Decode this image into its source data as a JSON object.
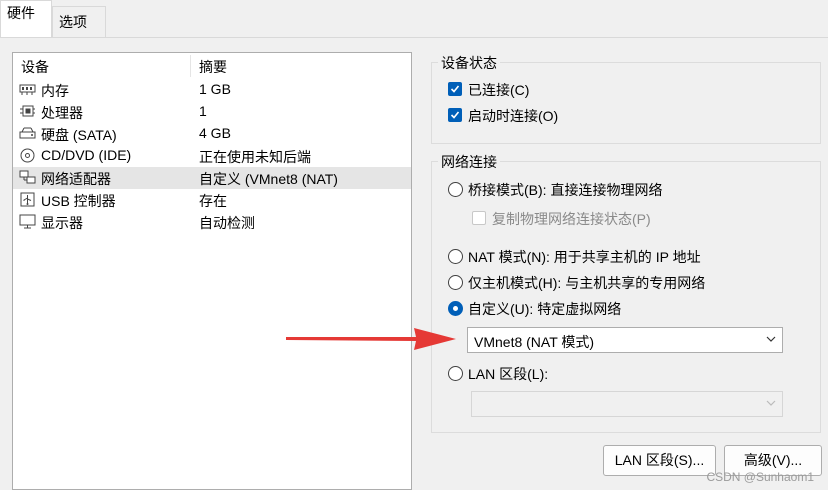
{
  "tabs": [
    {
      "label": "硬件",
      "active": true
    },
    {
      "label": "选项",
      "active": false
    }
  ],
  "hardware_list": {
    "columns": [
      "设备",
      "摘要"
    ],
    "rows": [
      {
        "icon": "memory-icon",
        "name": "内存",
        "summary": "1 GB",
        "selected": false
      },
      {
        "icon": "processor-icon",
        "name": "处理器",
        "summary": "1",
        "selected": false
      },
      {
        "icon": "hard-disk-icon",
        "name": "硬盘 (SATA)",
        "summary": "4 GB",
        "selected": false
      },
      {
        "icon": "cd-dvd-icon",
        "name": "CD/DVD (IDE)",
        "summary": "正在使用未知后端",
        "selected": false
      },
      {
        "icon": "network-adapter-icon",
        "name": "网络适配器",
        "summary": "自定义 (VMnet8 (NAT)",
        "selected": true
      },
      {
        "icon": "usb-icon",
        "name": "USB 控制器",
        "summary": "存在",
        "selected": false
      },
      {
        "icon": "display-icon",
        "name": "显示器",
        "summary": "自动检测",
        "selected": false
      }
    ]
  },
  "device_status": {
    "title": "设备状态",
    "connected": {
      "label": "已连接(C)",
      "checked": true
    },
    "connect_at_power_on": {
      "label": "启动时连接(O)",
      "checked": true
    }
  },
  "network_connection": {
    "title": "网络连接",
    "bridged": {
      "label": "桥接模式(B): 直接连接物理网络",
      "selected": false
    },
    "replicate_state": {
      "label": "复制物理网络连接状态(P)",
      "checked": false,
      "enabled": false
    },
    "nat": {
      "label": "NAT 模式(N): 用于共享主机的 IP 地址",
      "selected": false
    },
    "host_only": {
      "label": "仅主机模式(H): 与主机共享的专用网络",
      "selected": false
    },
    "custom": {
      "label": "自定义(U): 特定虚拟网络",
      "selected": true
    },
    "custom_network_select": {
      "value": "VMnet8 (NAT 模式)"
    },
    "lan_segment": {
      "label": "LAN 区段(L):",
      "selected": false
    },
    "lan_segment_select": {
      "value": "",
      "enabled": false
    }
  },
  "buttons": {
    "lan_segments": "LAN 区段(S)...",
    "advanced": "高级(V)..."
  },
  "annotation": {
    "arrow_color": "#e53935"
  },
  "watermark": "CSDN @Sunhaom1",
  "colors": {
    "accent": "#005fb8",
    "selection": "#e5e5e5"
  }
}
